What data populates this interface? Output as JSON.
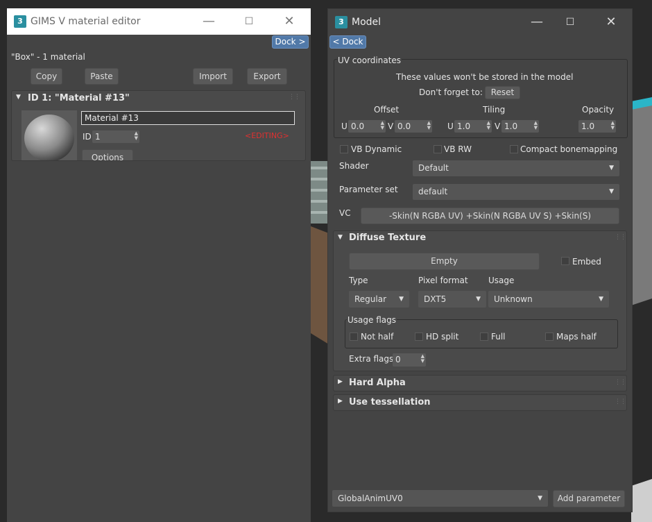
{
  "colors": {
    "accent_blue": "#5179a8",
    "editing_red": "#e03030",
    "window_bg": "#444444",
    "viewport_bg": "#2b2b2b"
  },
  "editor": {
    "title": "GIMS V material editor",
    "title_icon": "3",
    "dock_label": "Dock >",
    "summary": "\"Box\" - 1 material",
    "buttons": {
      "copy": "Copy",
      "paste": "Paste",
      "import": "Import",
      "export": "Export"
    },
    "material": {
      "header": "ID 1: \"Material #13\"",
      "name_value": "Material #13",
      "id_label": "ID",
      "id_value": "1",
      "editing": "<EDITING>",
      "options_label": "Options"
    }
  },
  "model": {
    "title": "Model",
    "title_icon": "3",
    "dock_label": "< Dock",
    "uv": {
      "group_label": "UV coordinates",
      "note": "These values won't be stored in the model",
      "forget": "Don't forget to:",
      "reset": "Reset",
      "offset_label": "Offset",
      "tiling_label": "Tiling",
      "opacity_label": "Opacity",
      "u_label": "U",
      "v_label": "V",
      "offset_u": "0.0",
      "offset_v": "0.0",
      "tiling_u": "1.0",
      "tiling_v": "1.0",
      "opacity": "1.0"
    },
    "checks": {
      "vb_dynamic": "VB Dynamic",
      "vb_rw": "VB RW",
      "compact": "Compact bonemapping"
    },
    "shader_label": "Shader",
    "shader_value": "Default",
    "paramset_label": "Parameter set",
    "paramset_value": "default",
    "vc_label": "VC",
    "vc_value": "-Skin(N RGBA UV) +Skin(N RGBA UV S) +Skin(S)",
    "diffuse": {
      "title": "Diffuse Texture",
      "empty_label": "Empty",
      "embed_label": "Embed",
      "type_label": "Type",
      "pixfmt_label": "Pixel format",
      "usage_label": "Usage",
      "type_value": "Regular",
      "pixfmt_value": "DXT5",
      "usage_value": "Unknown",
      "flags_label": "Usage flags",
      "flags": {
        "not_half": "Not half",
        "hd_split": "HD split",
        "full": "Full",
        "maps_half": "Maps half"
      },
      "extra_label": "Extra flags",
      "extra_value": "0"
    },
    "hard_alpha": "Hard Alpha",
    "tessellation": "Use tessellation",
    "bottom_select": "GlobalAnimUV0",
    "add_param": "Add parameter"
  }
}
